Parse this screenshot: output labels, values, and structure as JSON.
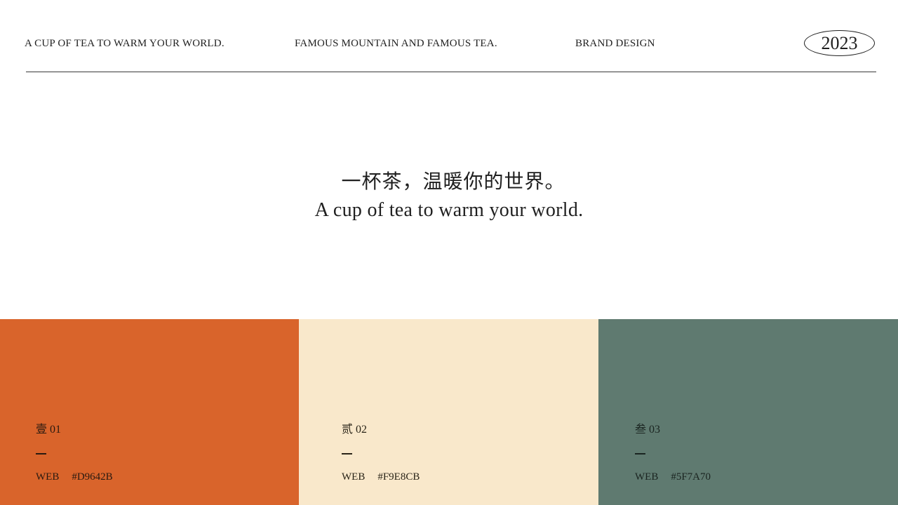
{
  "header": {
    "tagline_1": "A CUP OF TEA TO WARM YOUR WORLD.",
    "tagline_2": "FAMOUS MOUNTAIN AND FAMOUS TEA.",
    "tagline_3": "BRAND DESIGN",
    "year": "2023"
  },
  "hero": {
    "title_cn": "一杯茶，温暖你的世界。",
    "title_en": "A cup of tea to warm your world."
  },
  "palette": [
    {
      "index_cn": "壹",
      "index_num": "01",
      "dash": "—",
      "label": "WEB",
      "hex": "#D9642B",
      "color": "#D9642B",
      "text_color": "#2a1a10"
    },
    {
      "index_cn": "贰",
      "index_num": "02",
      "dash": "—",
      "label": "WEB",
      "hex": "#F9E8CB",
      "color": "#F9E8CB",
      "text_color": "#2a2418"
    },
    {
      "index_cn": "叁",
      "index_num": "03",
      "dash": "—",
      "label": "WEB",
      "hex": "#5F7A70",
      "color": "#5F7A70",
      "text_color": "#1a2420"
    }
  ]
}
